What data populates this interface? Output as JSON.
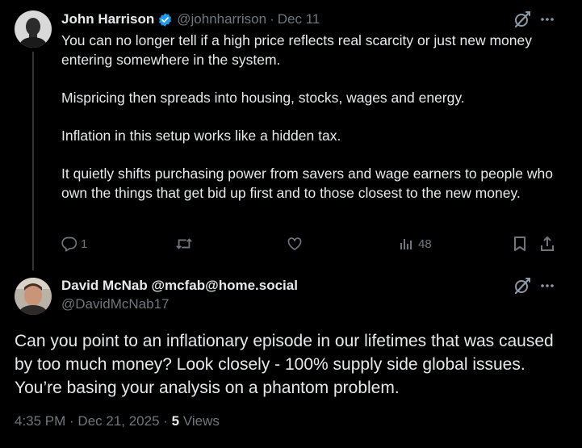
{
  "colors": {
    "background": "#000000",
    "text": "#e7e9ea",
    "secondary": "#71767b",
    "verified": "#1d9bf0",
    "thread_line": "#333639"
  },
  "tweet1": {
    "author_name": "John Harrison",
    "handle": "@johnharrison",
    "separator": "·",
    "date": "Dec 11",
    "verified_icon": "verified-badge-icon",
    "paragraphs": [
      "You can no longer tell if a high price reflects real scarcity or just new money entering somewhere in the system.",
      "Mispricing then spreads into housing, stocks, wages and energy.",
      "Inflation in this setup works like a hidden tax.",
      "It quietly shifts purchasing power from savers and wage earners to people who own the things that get bid up first and to those closest to the new money."
    ],
    "actions": {
      "reply_count": "1",
      "views_count": "48"
    }
  },
  "tweet2": {
    "author_name": "David McNab @mcfab@home.social",
    "handle": "@DavidMcNab17",
    "text": "Can you point to an inflationary episode in our lifetimes that was caused by too much money? Look closely - 100% supply side global issues. You’re basing your analysis on a phantom problem.",
    "timestamp": "4:35 PM · Dec 21, 2025 · ",
    "views_count": "5",
    "views_label": " Views"
  }
}
